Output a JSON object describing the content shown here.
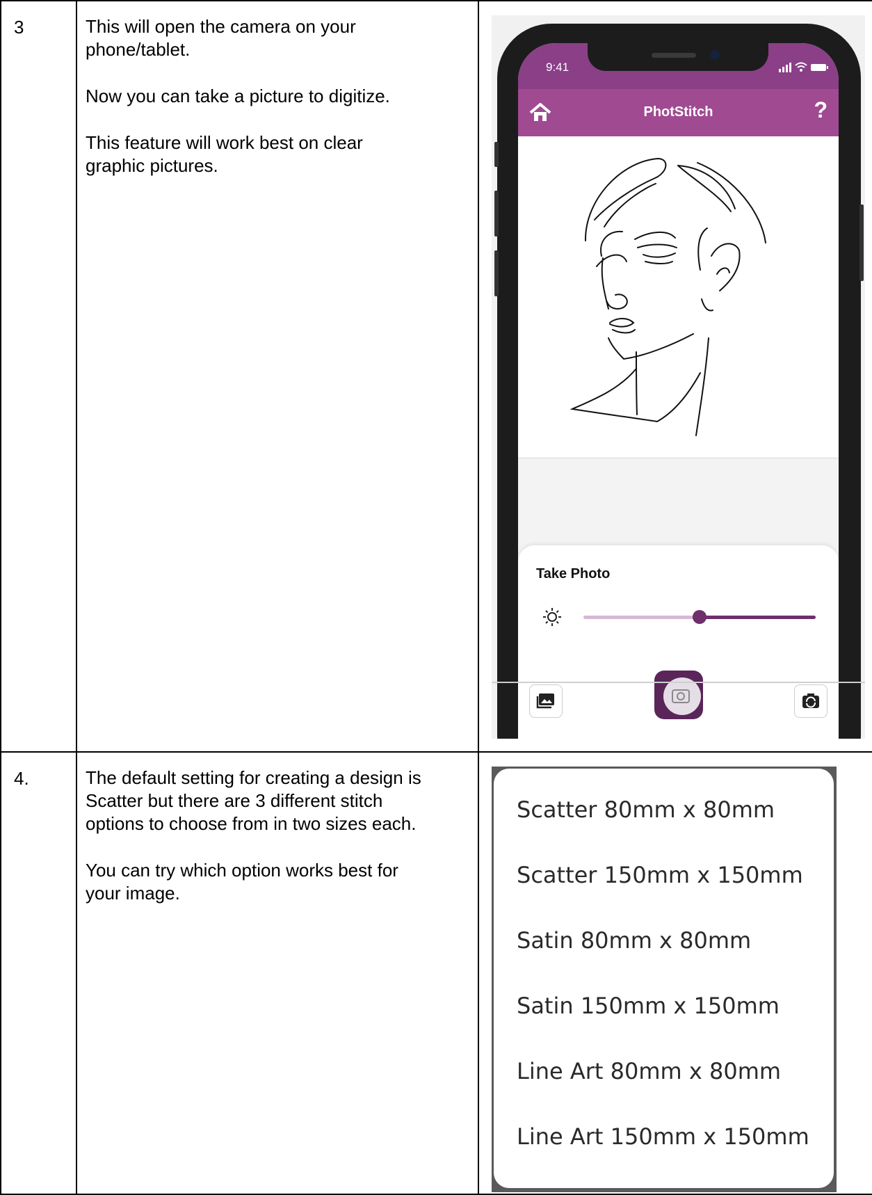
{
  "rows": [
    {
      "number": "3",
      "paragraphs": [
        "This will open the camera on your\nphone/tablet.",
        "Now you can take a picture to digitize.",
        "This feature will work best on clear\ngraphic pictures."
      ]
    },
    {
      "number": "4.",
      "paragraphs": [
        "The default setting for creating a design is\nScatter but there are 3 different stitch\noptions to choose from in two sizes each.",
        "You can try which option works best for\nyour image."
      ]
    }
  ],
  "phone": {
    "time": "9:41",
    "app_title": "PhotStitch",
    "help_label": "?",
    "sheet_title": "Take Photo",
    "brightness_level": 0.5,
    "colors": {
      "status_bar": "#8a3f87",
      "app_bar": "#a04a92",
      "accent": "#6f2e6c"
    },
    "icons": [
      "home-icon",
      "help-icon",
      "sun-icon",
      "gallery-icon",
      "camera-icon",
      "switch-camera-icon"
    ]
  },
  "stitch_options": [
    "Scatter 80mm x 80mm",
    "Scatter 150mm x 150mm",
    "Satin 80mm x 80mm",
    "Satin 150mm x 150mm",
    "Line Art 80mm x 80mm",
    "Line Art 150mm x 150mm"
  ]
}
